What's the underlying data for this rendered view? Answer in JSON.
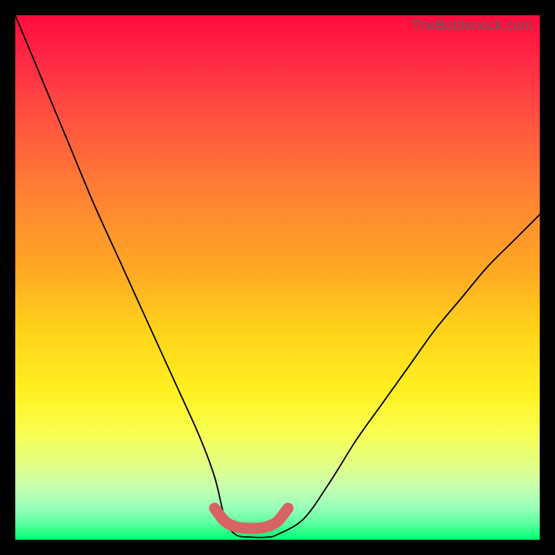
{
  "attribution": "TheBottleneck.com",
  "chart_data": {
    "type": "line",
    "title": "",
    "xlabel": "",
    "ylabel": "",
    "xlim": [
      0,
      100
    ],
    "ylim": [
      0,
      100
    ],
    "series": [
      {
        "name": "bottleneck-curve",
        "x": [
          0,
          5,
          10,
          15,
          20,
          25,
          30,
          35,
          38,
          40,
          42,
          45,
          48,
          50,
          55,
          60,
          65,
          70,
          75,
          80,
          85,
          90,
          95,
          100
        ],
        "values": [
          100,
          88,
          76,
          64,
          53,
          42,
          31,
          20,
          12,
          4,
          1,
          0.5,
          0.5,
          1,
          4,
          11,
          19,
          26,
          33,
          40,
          46,
          52,
          57,
          62
        ]
      },
      {
        "name": "optimal-band-marker",
        "x": [
          38,
          40,
          42,
          44,
          46,
          48,
          50,
          52
        ],
        "values": [
          6.0,
          3.5,
          2.5,
          2.2,
          2.2,
          2.5,
          3.5,
          6.0
        ]
      }
    ],
    "optimal_range": {
      "x_start": 38,
      "x_end": 52
    },
    "annotations": []
  }
}
